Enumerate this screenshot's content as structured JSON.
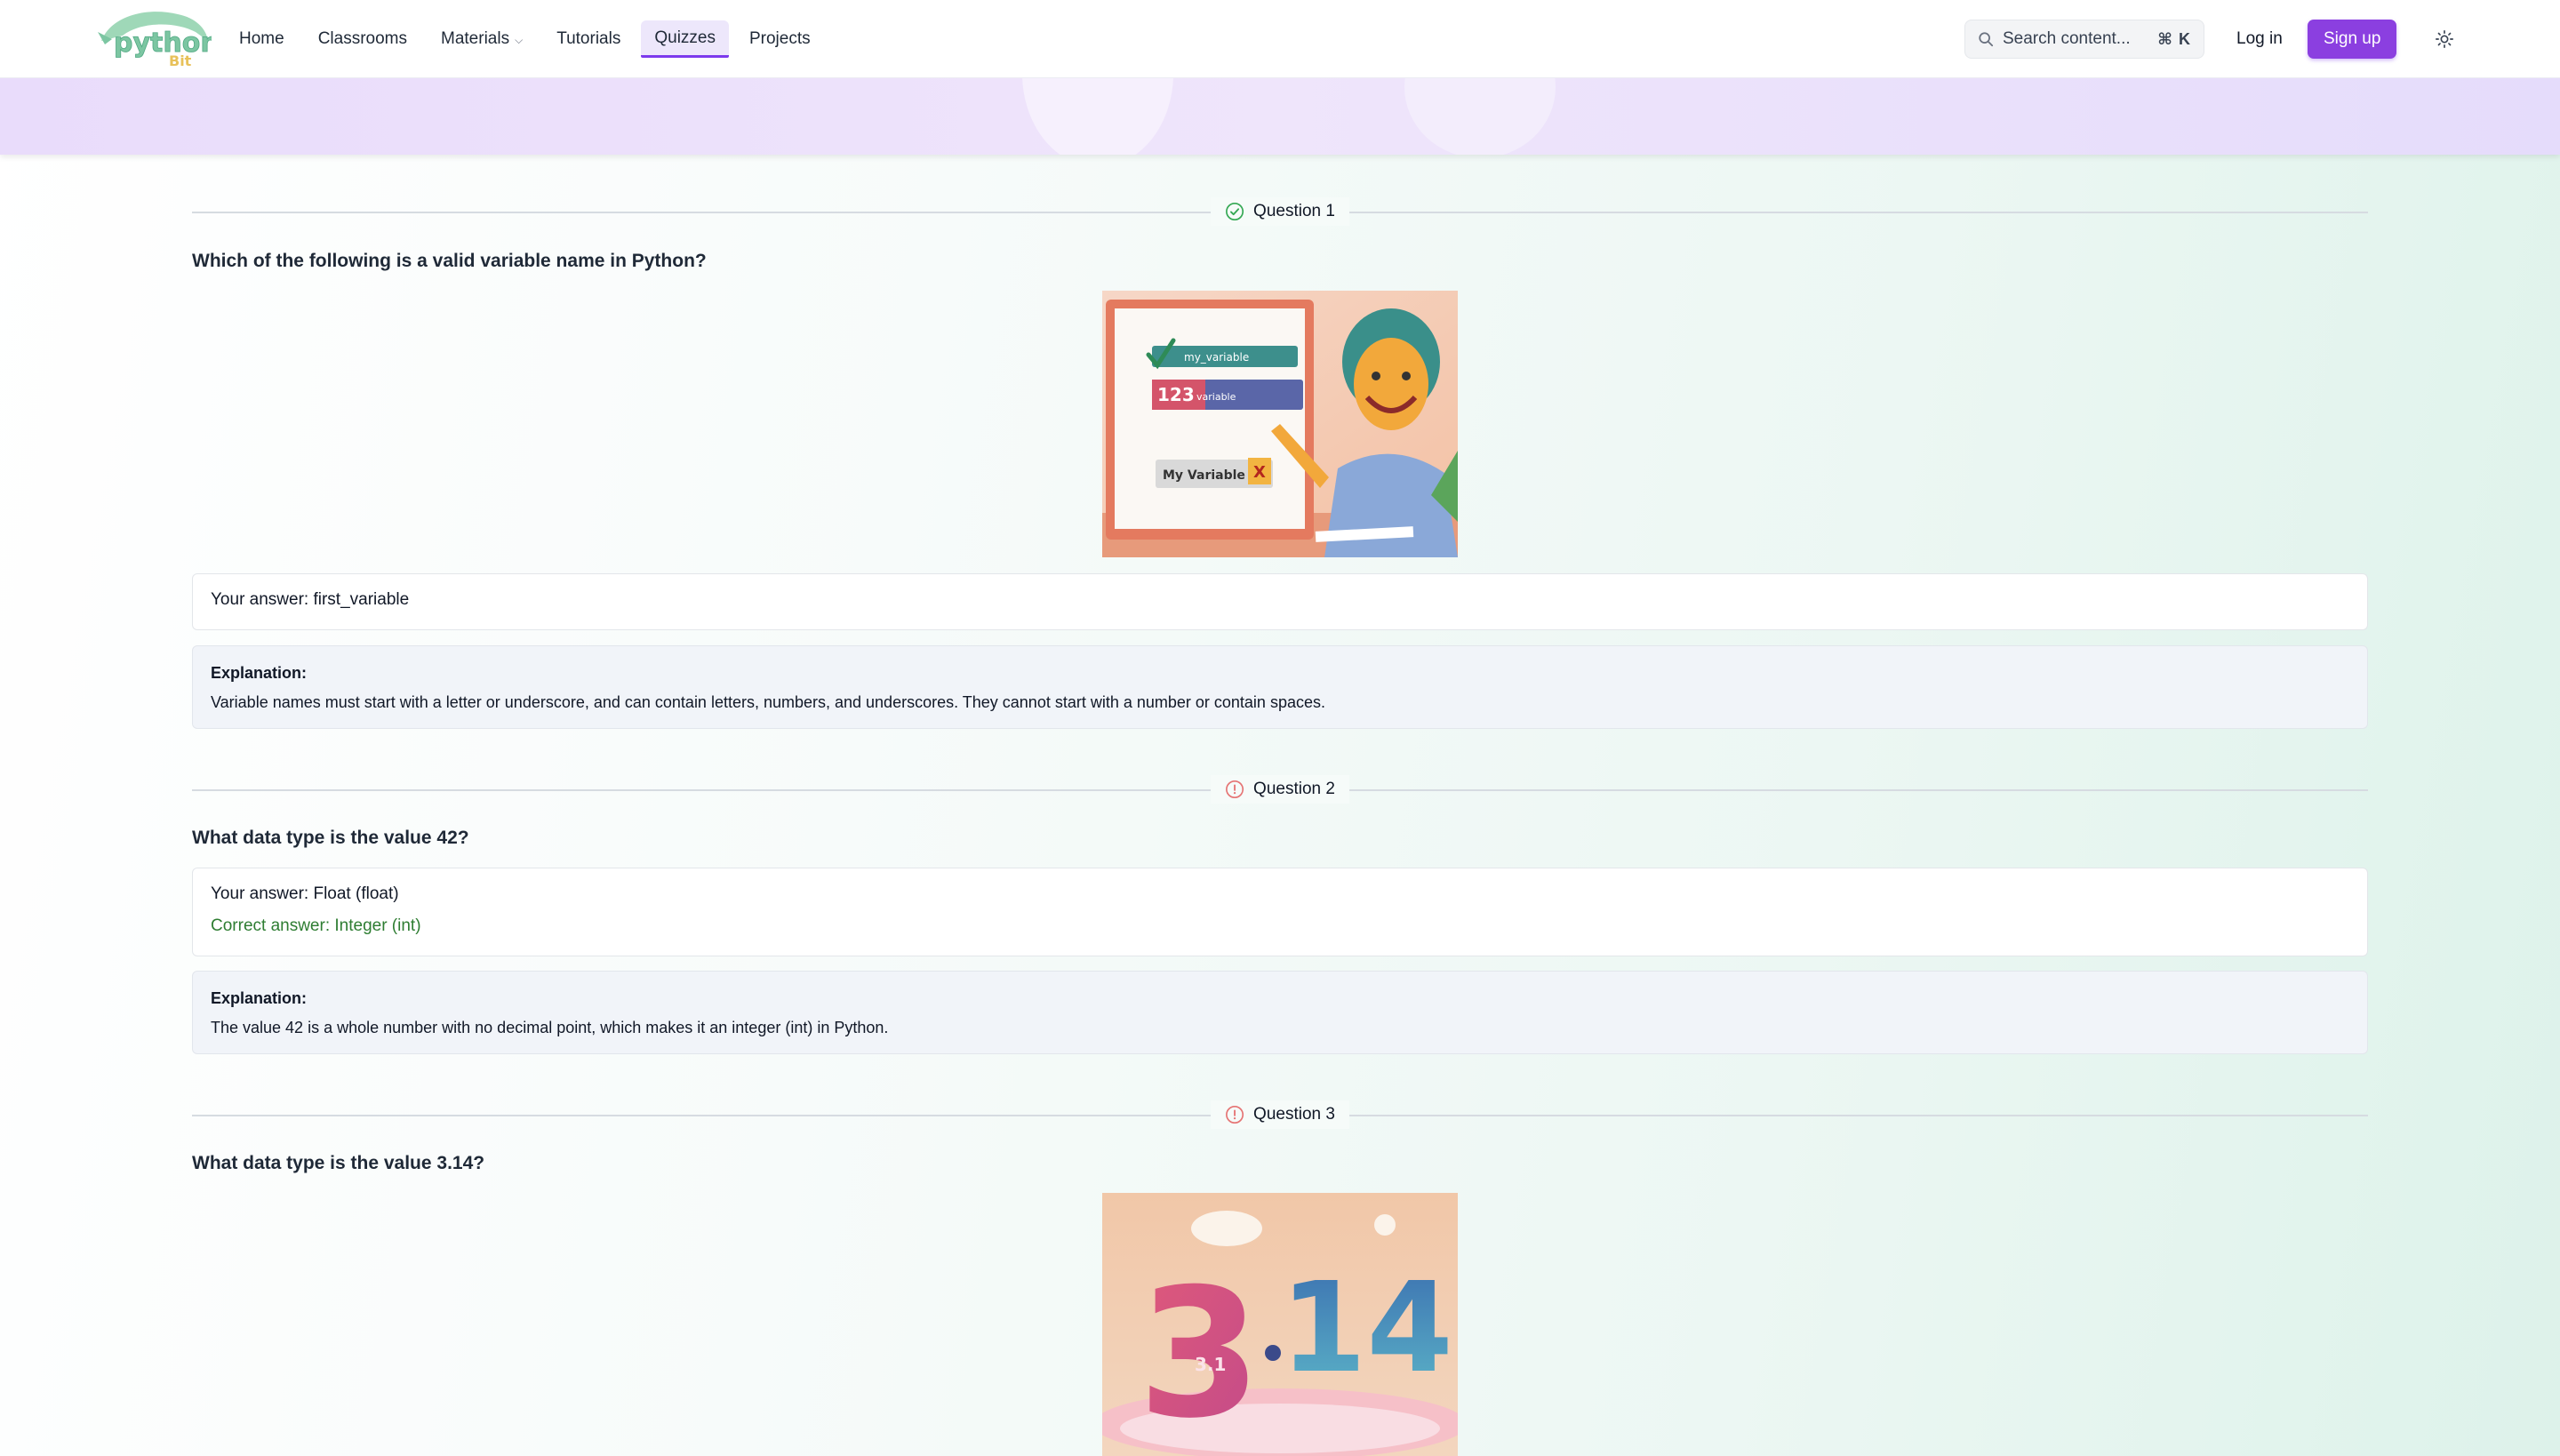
{
  "nav": {
    "logo_text": "python",
    "logo_sub": "Bit",
    "links": [
      {
        "label": "Home"
      },
      {
        "label": "Classrooms"
      },
      {
        "label": "Materials"
      },
      {
        "label": "Tutorials"
      },
      {
        "label": "Quizzes",
        "active": true
      },
      {
        "label": "Projects"
      }
    ],
    "search_placeholder": "Search content...",
    "search_shortcut": "⌘ K",
    "login_label": "Log in",
    "signup_label": "Sign up"
  },
  "colors": {
    "accent": "#8b3fe0",
    "correct": "#2e7d32",
    "incorrect": "#e57373",
    "check": "#34a853"
  },
  "questions": [
    {
      "label": "Question 1",
      "status_icon": "check-circle-icon",
      "text": "Which of the following is a valid variable name in Python?",
      "image": {
        "labels": [
          "my_variable",
          "123",
          "variable",
          "My Variable",
          "X"
        ]
      },
      "your_answer": "Your answer: first_variable",
      "explanation_title": "Explanation:",
      "explanation": "Variable names must start with a letter or underscore, and can contain letters, numbers, and underscores. They cannot start with a number or contain spaces."
    },
    {
      "label": "Question 2",
      "status_icon": "alert-circle-icon",
      "text": "What data type is the value 42?",
      "your_answer": "Your answer: Float (float)",
      "correct_answer": "Correct answer: Integer (int)",
      "explanation_title": "Explanation:",
      "explanation": "The value 42 is a whole number with no decimal point, which makes it an integer (int) in Python."
    },
    {
      "label": "Question 3",
      "status_icon": "alert-circle-icon",
      "text": "What data type is the value 3.14?",
      "image": {
        "labels": [
          "3.14",
          "3.1"
        ]
      }
    }
  ]
}
